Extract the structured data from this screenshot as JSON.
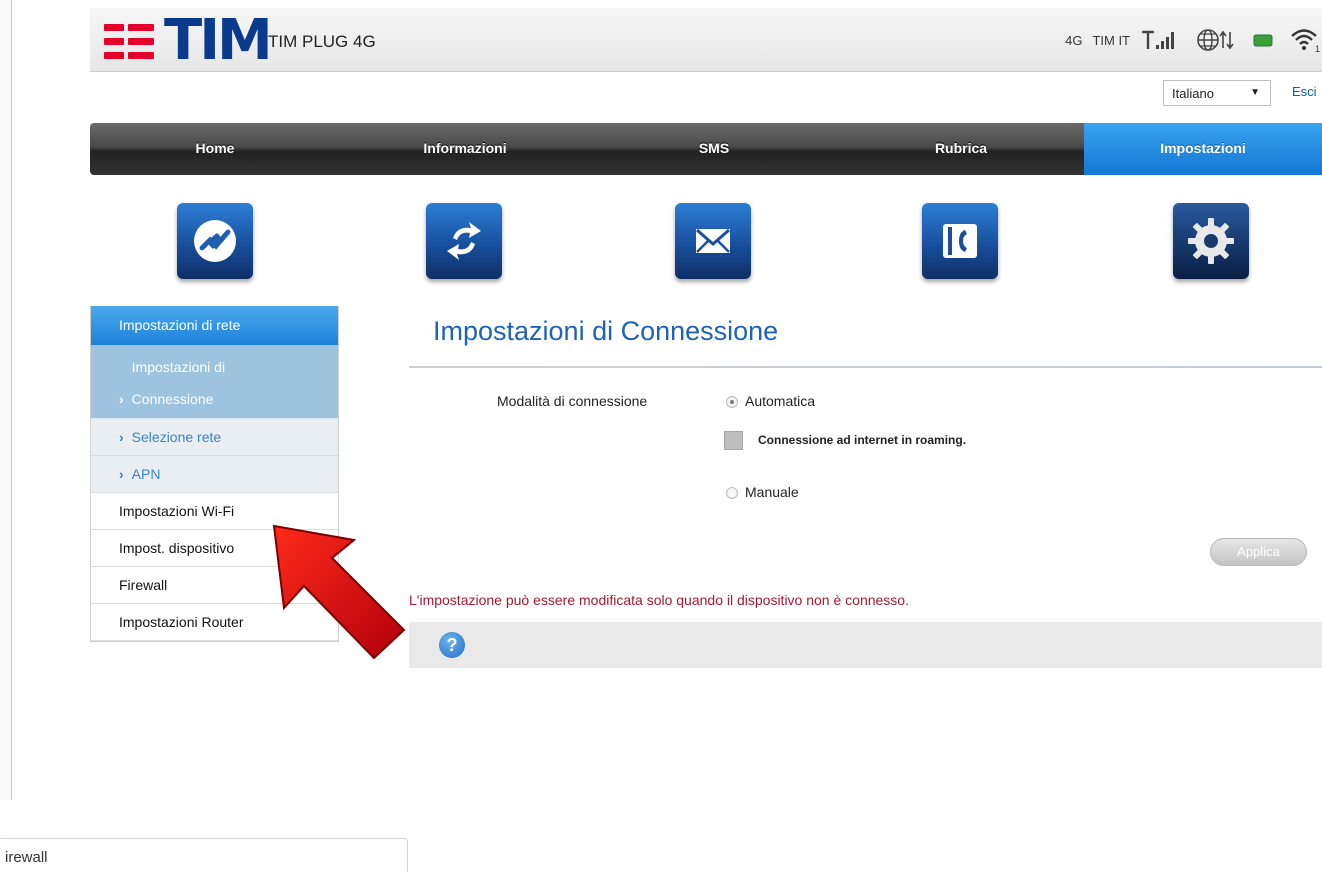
{
  "header": {
    "brand": "TIM",
    "product": "TIM PLUG 4G",
    "network_type": "4G",
    "operator": "TIM IT",
    "wifi_clients": "1"
  },
  "language": {
    "selected": "Italiano",
    "logout": "Esci"
  },
  "nav": {
    "tabs": [
      {
        "label": "Home"
      },
      {
        "label": "Informazioni"
      },
      {
        "label": "SMS"
      },
      {
        "label": "Rubrica"
      },
      {
        "label": "Impostazioni"
      }
    ],
    "active": "Impostazioni"
  },
  "icons": [
    "connection-icon",
    "refresh-icon",
    "mail-icon",
    "phonebook-icon",
    "settings-gear-icon"
  ],
  "sidebar": {
    "section": "Impostazioni di rete",
    "sub_items": [
      {
        "label": "Impostazioni di Connessione"
      },
      {
        "label": "Selezione rete"
      },
      {
        "label": "APN"
      }
    ],
    "items": [
      {
        "label": "Impostazioni Wi-Fi"
      },
      {
        "label": "Impost. dispositivo"
      },
      {
        "label": "Firewall"
      },
      {
        "label": "Impostazioni Router"
      }
    ]
  },
  "main": {
    "title": "Impostazioni di Connessione",
    "mode_label": "Modalità di connessione",
    "option_auto": "Automatica",
    "roaming_label": "Connessione ad internet in roaming.",
    "option_manual": "Manuale",
    "apply_label": "Applica",
    "warning": "L'impostazione può essere modificata solo quando il dispositivo non è connesso.",
    "help": "?"
  },
  "bottom_field": {
    "value": "irewall"
  },
  "colors": {
    "brand_blue": "#0a3a8c",
    "brand_red": "#e4002b",
    "active_tab": "#1e82d9",
    "warning": "#a8192e"
  }
}
